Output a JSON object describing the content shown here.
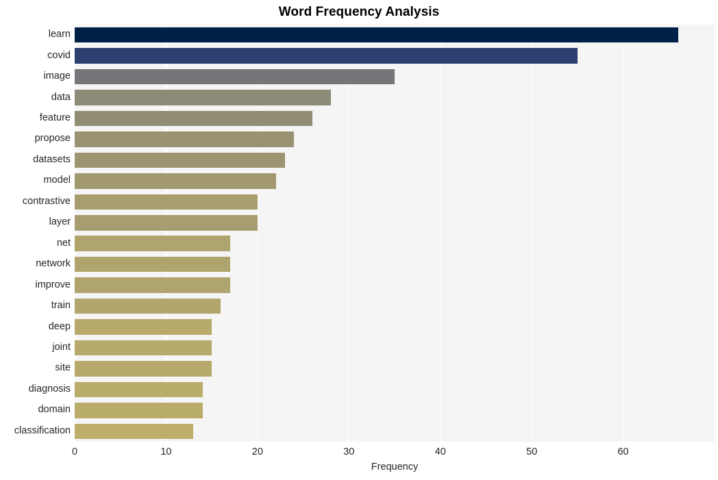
{
  "chart_data": {
    "type": "bar",
    "orientation": "horizontal",
    "title": "Word Frequency Analysis",
    "xlabel": "Frequency",
    "ylabel": "",
    "categories": [
      "learn",
      "covid",
      "image",
      "data",
      "feature",
      "propose",
      "datasets",
      "model",
      "contrastive",
      "layer",
      "net",
      "network",
      "improve",
      "train",
      "deep",
      "joint",
      "site",
      "diagnosis",
      "domain",
      "classification"
    ],
    "values": [
      66,
      55,
      35,
      28,
      26,
      24,
      23,
      22,
      20,
      20,
      17,
      17,
      17,
      16,
      15,
      15,
      15,
      14,
      14,
      13
    ],
    "bar_colors": [
      "#002147",
      "#2d3f6e",
      "#75767a",
      "#8d8a77",
      "#918d75",
      "#9a9372",
      "#9d9571",
      "#a29971",
      "#a89d6f",
      "#a89d6f",
      "#b0a46e",
      "#b0a46e",
      "#b0a46e",
      "#b3a66d",
      "#b7aa6c",
      "#b7aa6c",
      "#b7aa6c",
      "#baac6b",
      "#baac6b",
      "#bdae6a"
    ],
    "xlim": [
      0,
      70
    ],
    "xticks": [
      0,
      10,
      20,
      30,
      40,
      50,
      60
    ],
    "xtick_labels": [
      "0",
      "10",
      "20",
      "30",
      "40",
      "50",
      "60"
    ],
    "grid": "vertical-white",
    "plot_background": "#f5f5f5",
    "figure_background": "#ffffff",
    "legend": null
  }
}
